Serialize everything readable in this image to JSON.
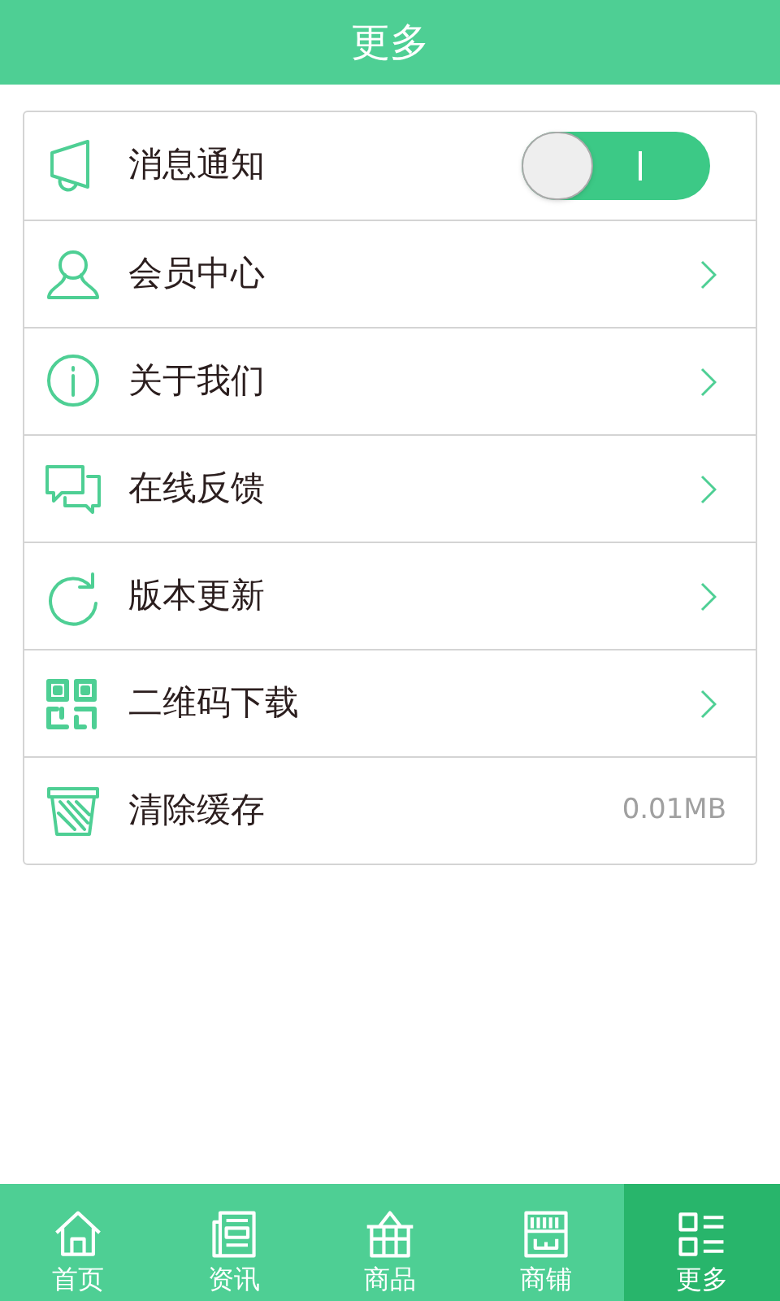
{
  "header": {
    "title": "更多"
  },
  "settings": [
    {
      "kind": "toggle",
      "label": "消息通知",
      "on": true
    },
    {
      "kind": "link",
      "label": "会员中心"
    },
    {
      "kind": "link",
      "label": "关于我们"
    },
    {
      "kind": "link",
      "label": "在线反馈"
    },
    {
      "kind": "link",
      "label": "版本更新"
    },
    {
      "kind": "link",
      "label": "二维码下载"
    },
    {
      "kind": "value",
      "label": "清除缓存",
      "value": "0.01MB"
    }
  ],
  "tab_bar": [
    {
      "label": "首页",
      "selected": false
    },
    {
      "label": "资讯",
      "selected": false
    },
    {
      "label": "商品",
      "selected": false
    },
    {
      "label": "商铺",
      "selected": false
    },
    {
      "label": "更多",
      "selected": true
    }
  ]
}
